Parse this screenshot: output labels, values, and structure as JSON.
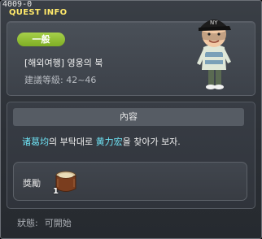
{
  "header": {
    "quest_id": "4009-0",
    "title": "QUEST INFO"
  },
  "quest": {
    "category_badge": "一般",
    "name": "[해외여행] 영웅의 북",
    "level_requirement": "建議等級: 42~46",
    "npc_icon": "npc-portrait"
  },
  "content": {
    "section_title": "內容",
    "description_parts": {
      "npc1": "诸葛均",
      "text1": "의 부탁대로 ",
      "npc2": "黄力宏",
      "text2": "을 찾아가 보자."
    }
  },
  "reward": {
    "label": "獎勵",
    "item_icon": "drum-icon",
    "item_count": "1"
  },
  "status": {
    "label": "狀態:",
    "value": "可開始"
  },
  "colors": {
    "title": "#ffe96a",
    "badge": "#8cbf2e",
    "highlight": "#6ee3f5"
  }
}
